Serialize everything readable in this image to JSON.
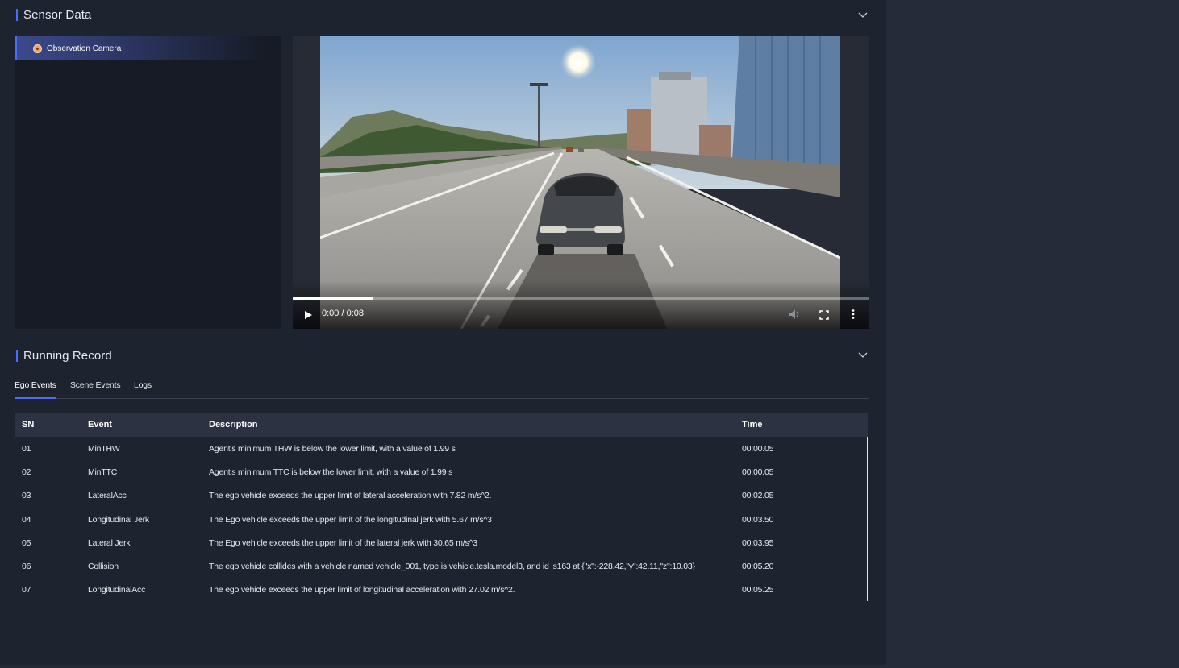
{
  "sensor_section": {
    "title": "Sensor Data",
    "camera_list": [
      {
        "label": "Observation Camera"
      }
    ],
    "video": {
      "time_readout": "0:00 / 0:08",
      "progress_fraction": 0.14
    }
  },
  "record_section": {
    "title": "Running Record",
    "tabs": [
      {
        "label": "Ego Events"
      },
      {
        "label": "Scene Events"
      },
      {
        "label": "Logs"
      }
    ],
    "table": {
      "headers": {
        "sn": "SN",
        "event": "Event",
        "description": "Description",
        "time": "Time"
      },
      "rows": [
        {
          "sn": "01",
          "event": "MinTHW",
          "description": "Agent's minimum THW is below the lower limit, with a value of 1.99 s",
          "time": "00:00.05"
        },
        {
          "sn": "02",
          "event": "MinTTC",
          "description": "Agent's minimum TTC is below the lower limit, with a value of 1.99 s",
          "time": "00:00.05"
        },
        {
          "sn": "03",
          "event": "LateralAcc",
          "description": "The ego vehicle exceeds the upper limit of lateral acceleration with 7.82 m/s^2.",
          "time": "00:02.05"
        },
        {
          "sn": "04",
          "event": "Longitudinal Jerk",
          "description": "The Ego vehicle exceeds the upper limit of the longitudinal jerk with 5.67 m/s^3",
          "time": "00:03.50"
        },
        {
          "sn": "05",
          "event": "Lateral Jerk",
          "description": "The Ego vehicle exceeds the upper limit of the lateral jerk with 30.65 m/s^3",
          "time": "00:03.95"
        },
        {
          "sn": "06",
          "event": "Collision",
          "description": "The ego vehicle collides with a vehicle named vehicle_001, type is vehicle.tesla.model3, and id is163 at {\"x\":-228.42,\"y\":42.11,\"z\":10.03}",
          "time": "00:05.20"
        },
        {
          "sn": "07",
          "event": "LongitudinalAcc",
          "description": "The ego vehicle exceeds the upper limit of longitudinal acceleration with 27.02 m/s^2.",
          "time": "00:05.25"
        }
      ]
    }
  },
  "colors": {
    "accent": "#4c6ef5",
    "panel_bg": "#1e2330",
    "table_header_bg": "#2c3242"
  }
}
